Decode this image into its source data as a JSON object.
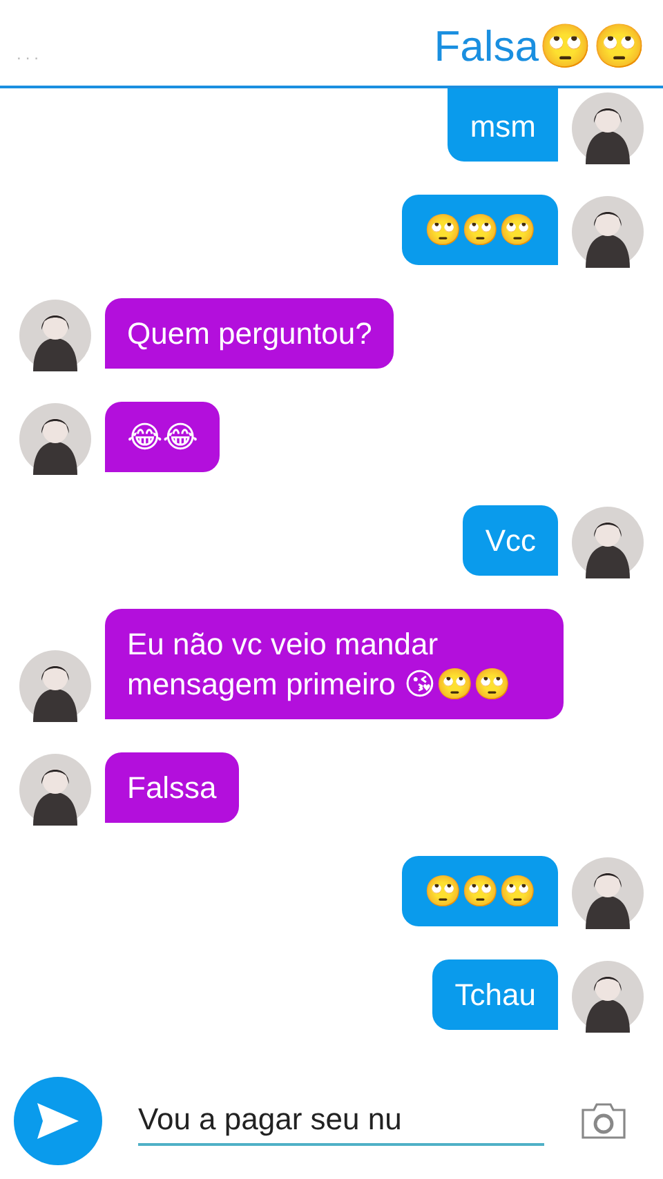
{
  "header": {
    "menu": "...",
    "contact_name": "Falsa🙄🙄"
  },
  "messages": [
    {
      "kind": "sent",
      "text": "msm"
    },
    {
      "kind": "sent",
      "text": "🙄🙄🙄"
    },
    {
      "kind": "received",
      "text": "Quem perguntou?"
    },
    {
      "kind": "received",
      "text": "😂😂"
    },
    {
      "kind": "sent",
      "text": "Vcc"
    },
    {
      "kind": "received",
      "text": "Eu não vc veio mandar mensagem primeiro 😘🙄🙄"
    },
    {
      "kind": "received",
      "text": "Falssa"
    },
    {
      "kind": "sent",
      "text": "🙄🙄🙄"
    },
    {
      "kind": "sent",
      "text": "Tchau"
    }
  ],
  "composer": {
    "value": "Vou a pagar seu nu"
  }
}
